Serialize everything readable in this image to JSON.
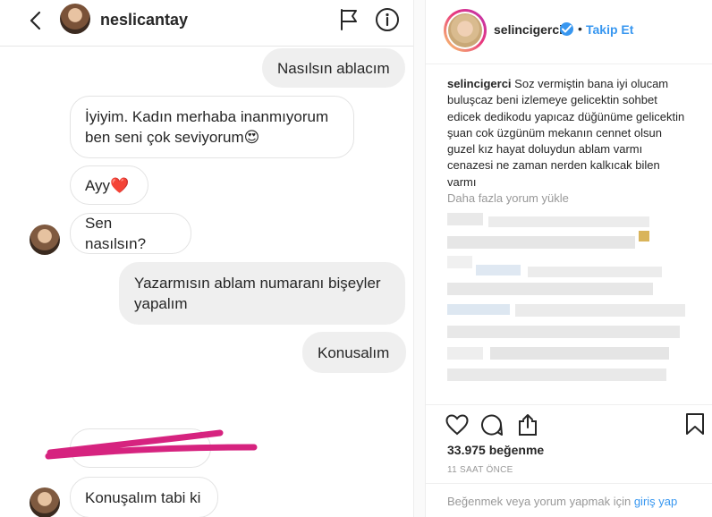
{
  "dm": {
    "username": "neslicantay",
    "messages": [
      {
        "from": "me",
        "text": "Nasılsın ablacım"
      },
      {
        "from": "them",
        "text": "İyiyim. Kadın merhaba inanmıyorum ben seni çok seviyorum😍"
      },
      {
        "from": "them",
        "text": "Ayy❤️"
      },
      {
        "from": "them",
        "text": "Sen nasılsın?"
      },
      {
        "from": "me",
        "text": "Yazarmısın ablam numaranı bişeyler yapalım"
      },
      {
        "from": "me",
        "text": "Konusalım"
      },
      {
        "from": "them",
        "text": "Konuşalım tabi ki"
      }
    ]
  },
  "post": {
    "username": "selincigerci",
    "separator": "•",
    "follow_label": "Takip Et",
    "caption_user": "selincigerci",
    "caption_text": "Soz vermiştin bana iyi olucam buluşcaz beni izlemeye gelicektin sohbet edicek dedikodu yapıcaz düğünüme gelicektin şuan cok üzgünüm mekanın cennet olsun guzel kız hayat doluydun ablam varmı cenazesi ne zaman nerden kalkıcak bilen varmı",
    "load_more": "Daha fazla yorum yükle",
    "likes_count": "33.975",
    "likes_label": "beğenme",
    "time": "11 SAAT ÖNCE",
    "login_prompt": "Beğenmek veya yorum yapmak için",
    "login_link": "giriş yap"
  },
  "colors": {
    "accent": "#3897f0",
    "scribble": "#d6237f",
    "bubble_me": "#efefef",
    "muted": "#999999"
  }
}
